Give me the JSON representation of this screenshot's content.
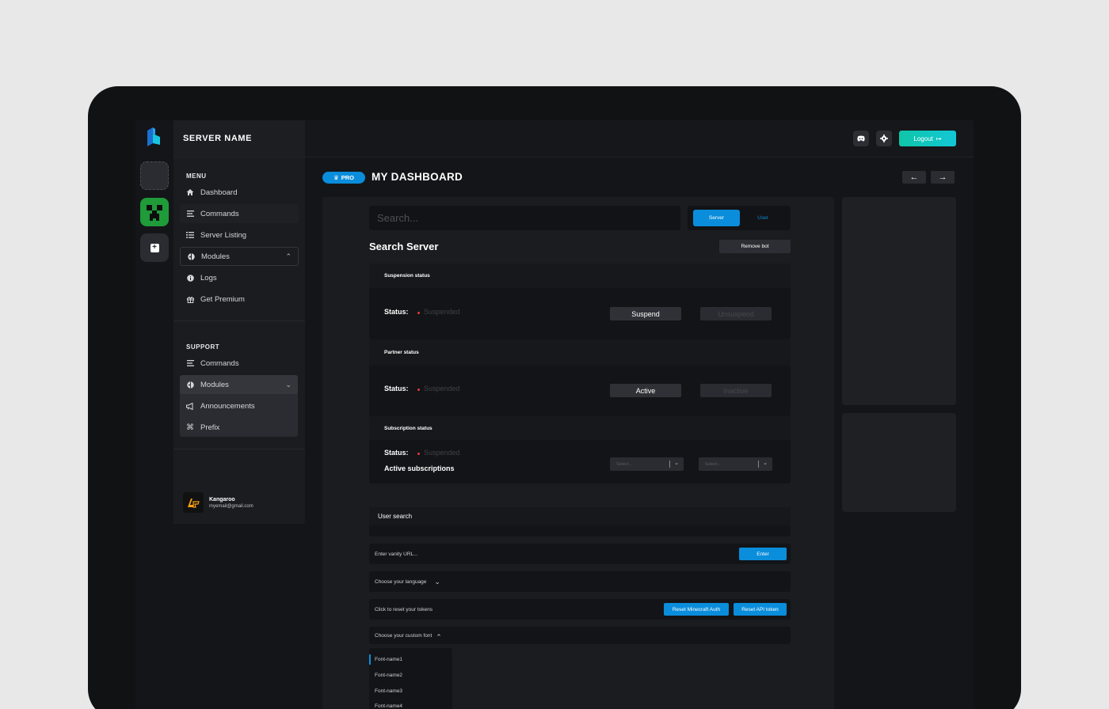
{
  "server": {
    "name": "SERVER NAME"
  },
  "menu": {
    "label": "MENU",
    "items": [
      {
        "label": "Dashboard",
        "icon": "home-icon"
      },
      {
        "label": "Commands",
        "icon": "list-icon"
      },
      {
        "label": "Server Listing",
        "icon": "list-check-icon"
      },
      {
        "label": "Modules",
        "icon": "module-icon"
      },
      {
        "label": "Logs",
        "icon": "info-icon"
      },
      {
        "label": "Get Premium",
        "icon": "gift-icon"
      }
    ]
  },
  "support": {
    "label": "SUPPORT",
    "items": [
      {
        "label": "Commands",
        "icon": "list-icon"
      },
      {
        "label": "Modules",
        "icon": "module-icon"
      },
      {
        "label": "Announcements",
        "icon": "megaphone-icon"
      },
      {
        "label": "Prefix",
        "icon": "command-icon"
      }
    ]
  },
  "user": {
    "name": "Kangaroo",
    "email": "myemail@gmail.com"
  },
  "topbar": {
    "logout_label": "Logout"
  },
  "page": {
    "badge": "PRO",
    "title": "MY DASHBOARD"
  },
  "search": {
    "placeholder": "Search...",
    "tab_server": "Server",
    "tab_user": "User"
  },
  "search_server": {
    "title": "Search Server",
    "remove_bot": "Remove bot"
  },
  "suspension": {
    "title": "Suspension status",
    "status_label": "Status:",
    "status_value": "Suspended",
    "btn_primary": "Suspend",
    "btn_secondary": "Unsuspend"
  },
  "partner": {
    "title": "Partner status",
    "status_label": "Status:",
    "status_value": "Suspended",
    "btn_primary": "Active",
    "btn_secondary": "Inactive"
  },
  "subscription": {
    "title": "Subscription status",
    "status_label": "Status:",
    "status_value": "Suspended",
    "active_label": "Active subscriptions",
    "select1": "Select...",
    "select2": "Select..."
  },
  "user_search": {
    "title": "User search"
  },
  "vanity": {
    "placeholder": "Enter vanity URL...",
    "button": "Enter"
  },
  "language": {
    "label": "Choose your language"
  },
  "tokens": {
    "label": "Click to reset your tokens",
    "btn_minecraft": "Reset Minecraft Auth",
    "btn_api": "Reset API token"
  },
  "font": {
    "label": "Choose your custom font",
    "options": [
      "Font-name1",
      "Font-name2",
      "Font-name3",
      "Font-name4"
    ]
  },
  "colors": {
    "accent": "#0a8ddb",
    "logout_gradient_start": "#0fc6a8",
    "status_dot": "#e23a3a",
    "minecraft_green": "#1f9b3a"
  }
}
